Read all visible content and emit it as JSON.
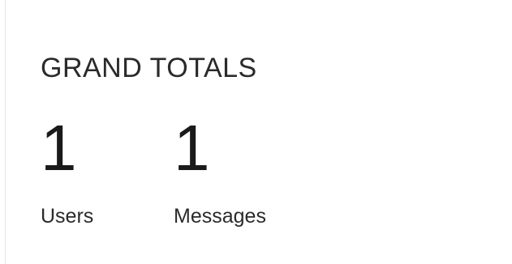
{
  "grand_totals": {
    "title": "GRAND TOTALS",
    "stats": [
      {
        "value": "1",
        "label": "Users"
      },
      {
        "value": "1",
        "label": "Messages"
      }
    ]
  }
}
